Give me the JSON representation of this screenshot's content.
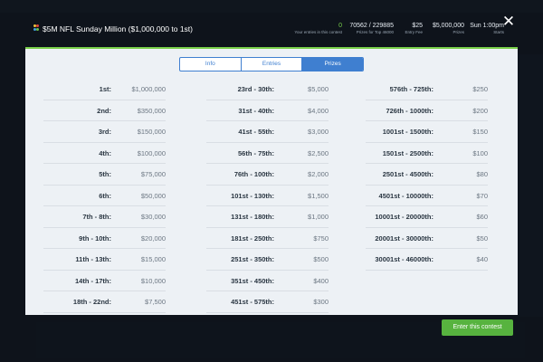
{
  "header": {
    "title": "$5M NFL Sunday Million ($1,000,000 to 1st)",
    "entries_value": "0",
    "entries_label": "Your entries in this contest",
    "prizes_value": "70562 / 229885",
    "prizes_label": "Prizes for Top 46000",
    "fee_value": "$25",
    "fee_label": "Entry Fee",
    "total_value": "$5,000,000",
    "total_label": "Prizes",
    "start_value": "Sun 1:00pm",
    "start_label": "Starts",
    "close_glyph": "✕"
  },
  "tabs": [
    {
      "label": "Info"
    },
    {
      "label": "Entries"
    },
    {
      "label": "Prizes"
    }
  ],
  "colors": {
    "accent": "#79d04a",
    "tab_blue": "#3f7fd0",
    "enter_green": "#57b33f"
  },
  "prizes": {
    "col1": [
      {
        "place": "1st:",
        "amount": "$1,000,000"
      },
      {
        "place": "2nd:",
        "amount": "$350,000"
      },
      {
        "place": "3rd:",
        "amount": "$150,000"
      },
      {
        "place": "4th:",
        "amount": "$100,000"
      },
      {
        "place": "5th:",
        "amount": "$75,000"
      },
      {
        "place": "6th:",
        "amount": "$50,000"
      },
      {
        "place": "7th - 8th:",
        "amount": "$30,000"
      },
      {
        "place": "9th - 10th:",
        "amount": "$20,000"
      },
      {
        "place": "11th - 13th:",
        "amount": "$15,000"
      },
      {
        "place": "14th - 17th:",
        "amount": "$10,000"
      },
      {
        "place": "18th - 22nd:",
        "amount": "$7,500"
      }
    ],
    "col2": [
      {
        "place": "23rd - 30th:",
        "amount": "$5,000"
      },
      {
        "place": "31st - 40th:",
        "amount": "$4,000"
      },
      {
        "place": "41st - 55th:",
        "amount": "$3,000"
      },
      {
        "place": "56th - 75th:",
        "amount": "$2,500"
      },
      {
        "place": "76th - 100th:",
        "amount": "$2,000"
      },
      {
        "place": "101st - 130th:",
        "amount": "$1,500"
      },
      {
        "place": "131st - 180th:",
        "amount": "$1,000"
      },
      {
        "place": "181st - 250th:",
        "amount": "$750"
      },
      {
        "place": "251st - 350th:",
        "amount": "$500"
      },
      {
        "place": "351st - 450th:",
        "amount": "$400"
      },
      {
        "place": "451st - 575th:",
        "amount": "$300"
      }
    ],
    "col3": [
      {
        "place": "576th - 725th:",
        "amount": "$250"
      },
      {
        "place": "726th - 1000th:",
        "amount": "$200"
      },
      {
        "place": "1001st - 1500th:",
        "amount": "$150"
      },
      {
        "place": "1501st - 2500th:",
        "amount": "$100"
      },
      {
        "place": "2501st - 4500th:",
        "amount": "$80"
      },
      {
        "place": "4501st - 10000th:",
        "amount": "$70"
      },
      {
        "place": "10001st - 20000th:",
        "amount": "$60"
      },
      {
        "place": "20001st - 30000th:",
        "amount": "$50"
      },
      {
        "place": "30001st - 46000th:",
        "amount": "$40"
      }
    ]
  },
  "enter_button": "Enter this contest"
}
